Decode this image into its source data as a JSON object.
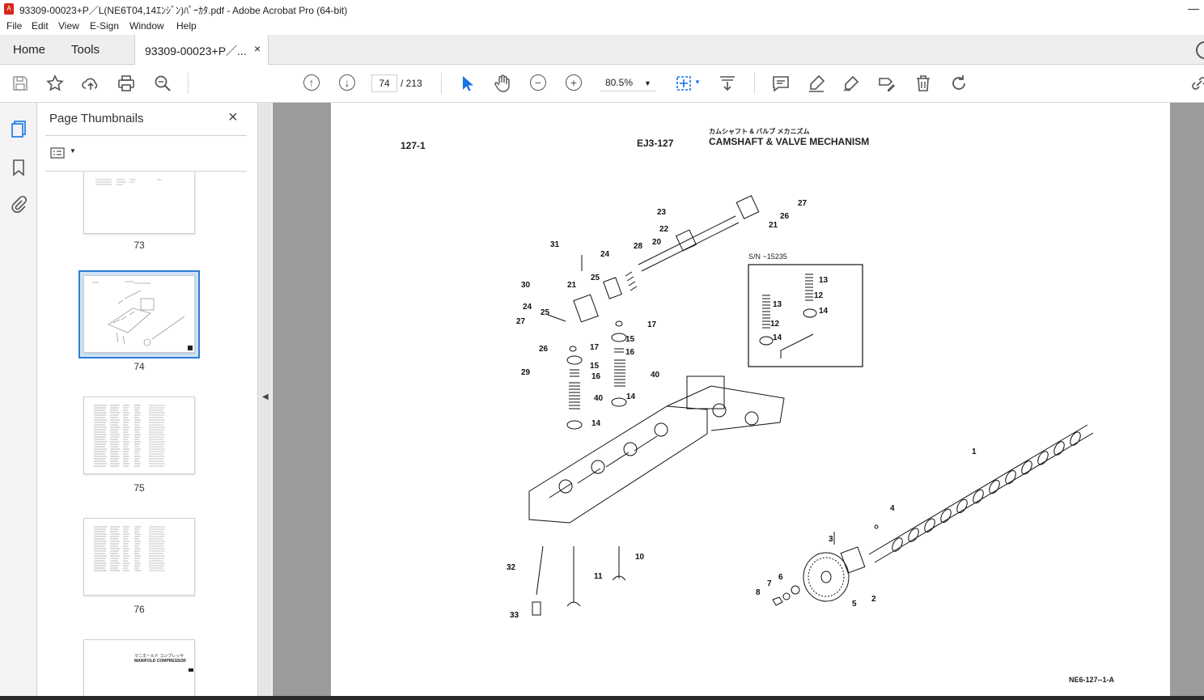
{
  "window": {
    "title": "93309-00023+P／L(NE6T04,14ｴﾝｼﾞﾝ)ﾊﾟｰｶﾀ.pdf - Adobe Acrobat Pro (64-bit)"
  },
  "menu": [
    "File",
    "Edit",
    "View",
    "E-Sign",
    "Window",
    "Help"
  ],
  "tabs": {
    "home": "Home",
    "tools": "Tools",
    "document": "93309-00023+P／...",
    "close": "×"
  },
  "toolbar": {
    "current_page": "74",
    "total_pages": "/ 213",
    "zoom": "80.5%"
  },
  "panel": {
    "title": "Page Thumbnails",
    "close": "×",
    "thumbnails": [
      {
        "label": "73"
      },
      {
        "label": "74",
        "selected": true
      },
      {
        "label": "75"
      },
      {
        "label": "76"
      }
    ],
    "partial_thumb_text": {
      "jp": "マニホールド コンプレッサ",
      "en": "MANIFOLD COMPRESSOR"
    }
  },
  "document": {
    "ref": "127-1",
    "code": "EJ3-127",
    "title_jp": "カムシャフト & バルブ メカニズム",
    "title_en": "CAMSHAFT & VALVE MECHANISM",
    "inset_label": "S/N ~15235",
    "figure_code": "NE6-127--1-A",
    "callouts": [
      "1",
      "2",
      "3",
      "4",
      "5",
      "6",
      "7",
      "8",
      "10",
      "11",
      "12",
      "13",
      "14",
      "15",
      "16",
      "17",
      "20",
      "21",
      "22",
      "23",
      "24",
      "25",
      "26",
      "27",
      "28",
      "29",
      "30",
      "31",
      "32",
      "33",
      "40"
    ]
  },
  "colors": {
    "selected_thumb_border": "#2d7dd2",
    "accent_blue": "#1473e6",
    "doc_bg": "#9b9b9b"
  }
}
